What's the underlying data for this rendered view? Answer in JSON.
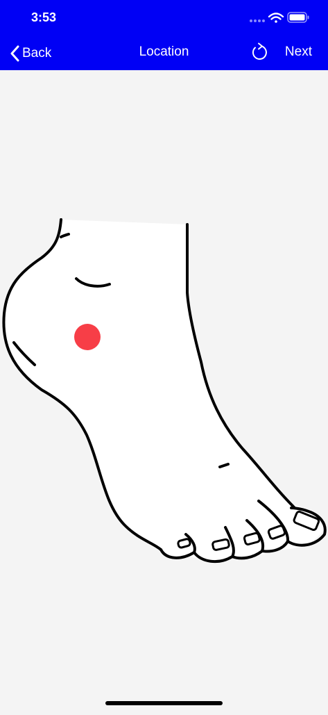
{
  "status_bar": {
    "time": "3:53",
    "signal_icon": "signal-dots-icon",
    "wifi_icon": "wifi-icon",
    "battery_icon": "battery-icon"
  },
  "nav_bar": {
    "back_label": "Back",
    "back_icon": "chevron-left-icon",
    "title": "Location",
    "refresh_icon": "refresh-icon",
    "next_label": "Next"
  },
  "body_map": {
    "figure": "foot-illustration",
    "marker_color": "#f73e47",
    "marker_icon": "location-marker-dot"
  },
  "colors": {
    "header_bg": "#0000f5",
    "header_text": "#ffffff",
    "page_bg": "#f4f4f4"
  }
}
